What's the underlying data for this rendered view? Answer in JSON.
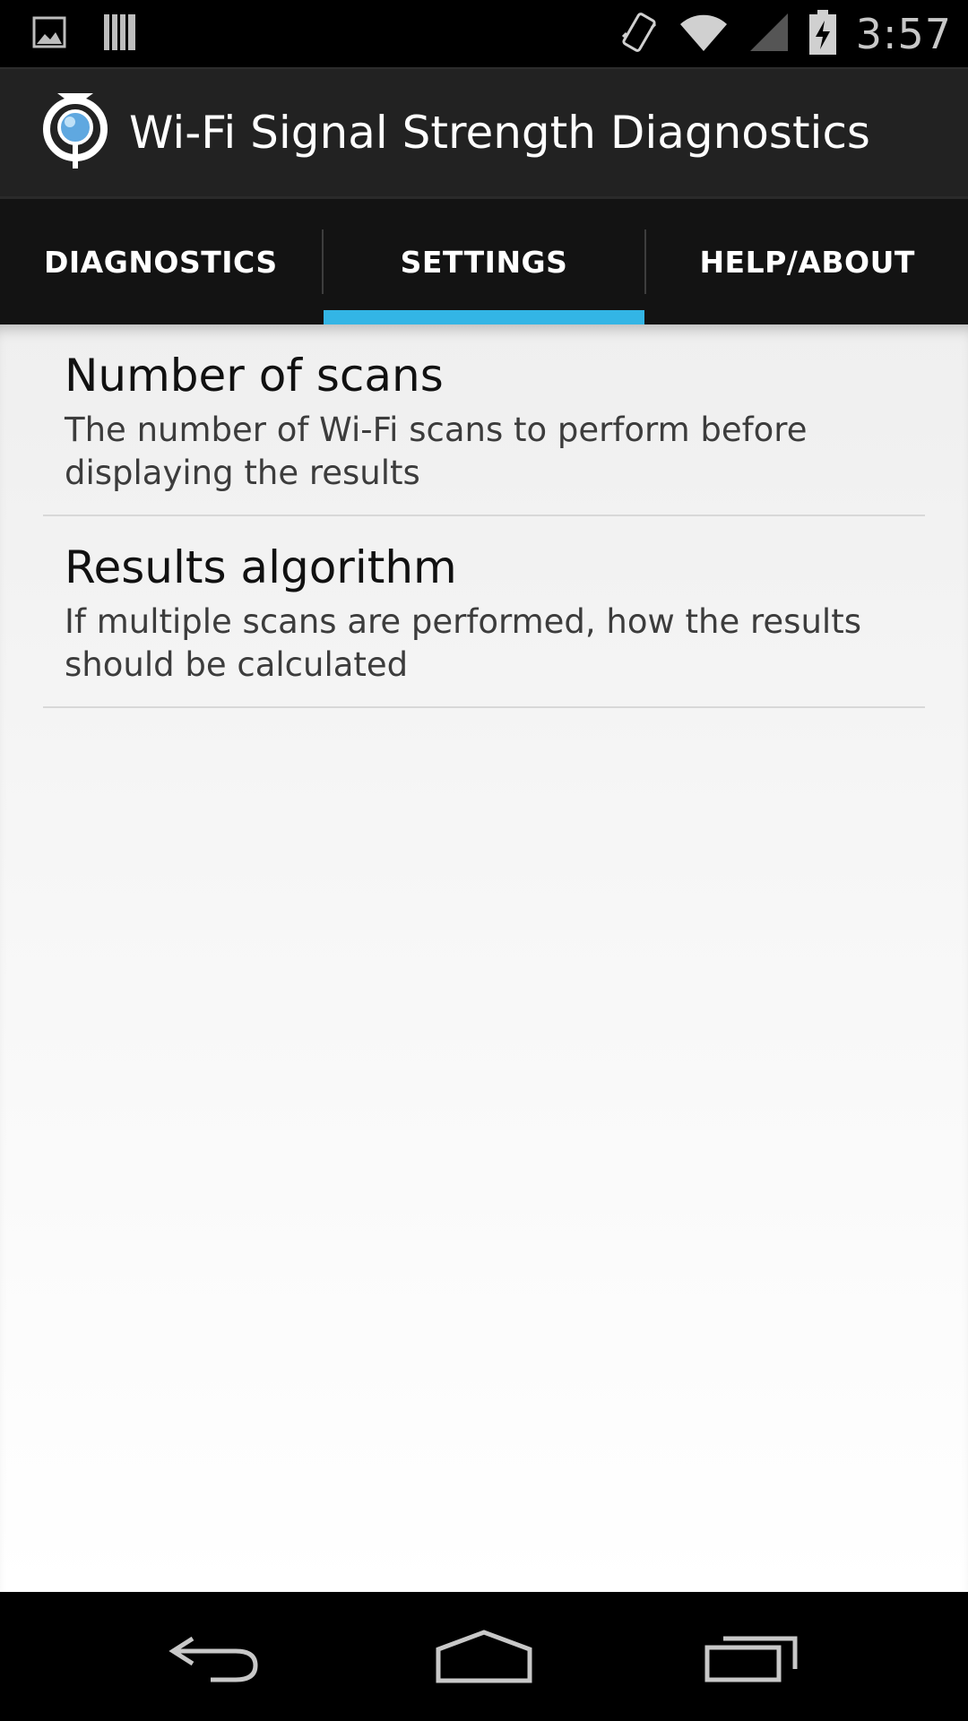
{
  "status_bar": {
    "time": "3:57",
    "icons": [
      "image-notification-icon",
      "barcode-notification-icon",
      "vibrate-icon",
      "wifi-icon",
      "cell-signal-icon",
      "battery-charging-icon"
    ]
  },
  "action_bar": {
    "title": "Wi-Fi Signal Strength Diagnostics",
    "icon": "app-logo-icon"
  },
  "tabs": [
    {
      "label": "DIAGNOSTICS",
      "selected": false
    },
    {
      "label": "SETTINGS",
      "selected": true
    },
    {
      "label": "HELP/ABOUT",
      "selected": false
    }
  ],
  "preferences": [
    {
      "title": "Number of scans",
      "summary": "The number of Wi-Fi scans to perform before displaying the results"
    },
    {
      "title": "Results algorithm",
      "summary": "If multiple scans are performed, how the results should be calculated"
    }
  ],
  "colors": {
    "accent": "#33b5e5",
    "action_bar": "#222222",
    "tab_bar": "#131313"
  },
  "nav_bar": {
    "icons": [
      "back-icon",
      "home-icon",
      "recent-apps-icon"
    ]
  }
}
